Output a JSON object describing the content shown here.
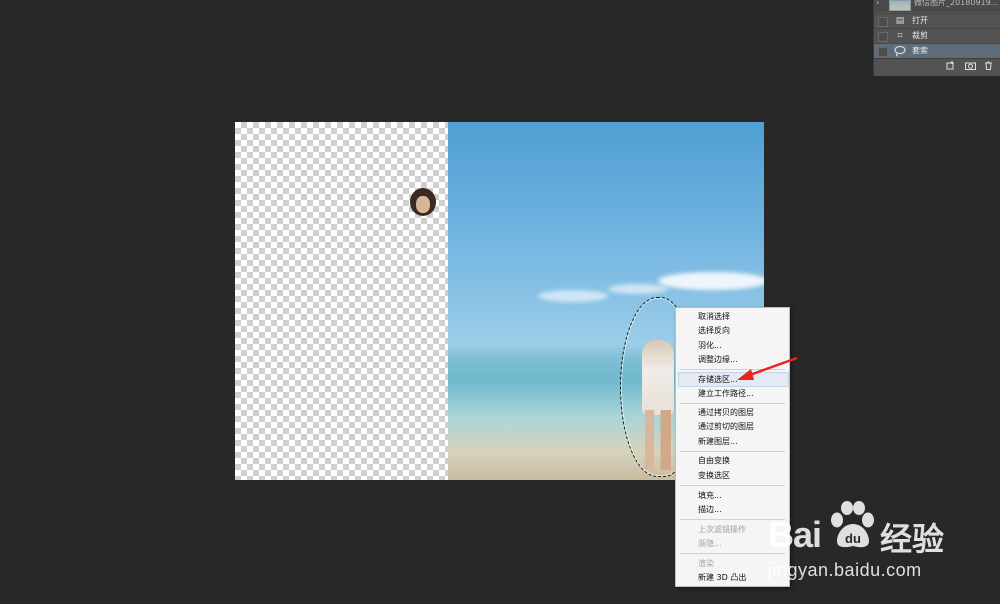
{
  "history_panel": {
    "snapshot_label": "微信图片_20180919...",
    "items": [
      {
        "label": "打开",
        "icon": "document-icon"
      },
      {
        "label": "裁剪",
        "icon": "crop-icon"
      },
      {
        "label": "套索",
        "icon": "lasso-icon",
        "selected": true
      }
    ],
    "footer_icons": [
      "new-document-from-state-icon",
      "camera-icon",
      "trash-icon"
    ]
  },
  "context_menu": {
    "items": [
      {
        "label": "取消选择",
        "enabled": true
      },
      {
        "label": "选择反向",
        "enabled": true
      },
      {
        "label": "羽化...",
        "enabled": true
      },
      {
        "label": "调整边缘...",
        "enabled": true
      },
      {
        "label": "存储选区...",
        "enabled": true,
        "highlighted": true
      },
      {
        "label": "建立工作路径...",
        "enabled": true
      },
      {
        "label": "通过拷贝的图层",
        "enabled": true
      },
      {
        "label": "通过剪切的图层",
        "enabled": true
      },
      {
        "label": "新建图层...",
        "enabled": true
      },
      {
        "label": "自由变换",
        "enabled": true
      },
      {
        "label": "变换选区",
        "enabled": true
      },
      {
        "label": "填充...",
        "enabled": true
      },
      {
        "label": "描边...",
        "enabled": true
      },
      {
        "label": "上次滤镜操作",
        "enabled": false
      },
      {
        "label": "渐隐...",
        "enabled": false
      },
      {
        "label": "渲染",
        "enabled": false
      },
      {
        "label": "新建 3D 凸出",
        "enabled": true
      }
    ]
  },
  "watermark": {
    "brand_bai": "Bai",
    "brand_jingyan": "经验",
    "url": "jingyan.baidu.com"
  },
  "colors": {
    "workspace_bg": "#282828",
    "annotation_arrow": "#e8261f",
    "menu_highlight": "#e3eaf4"
  }
}
